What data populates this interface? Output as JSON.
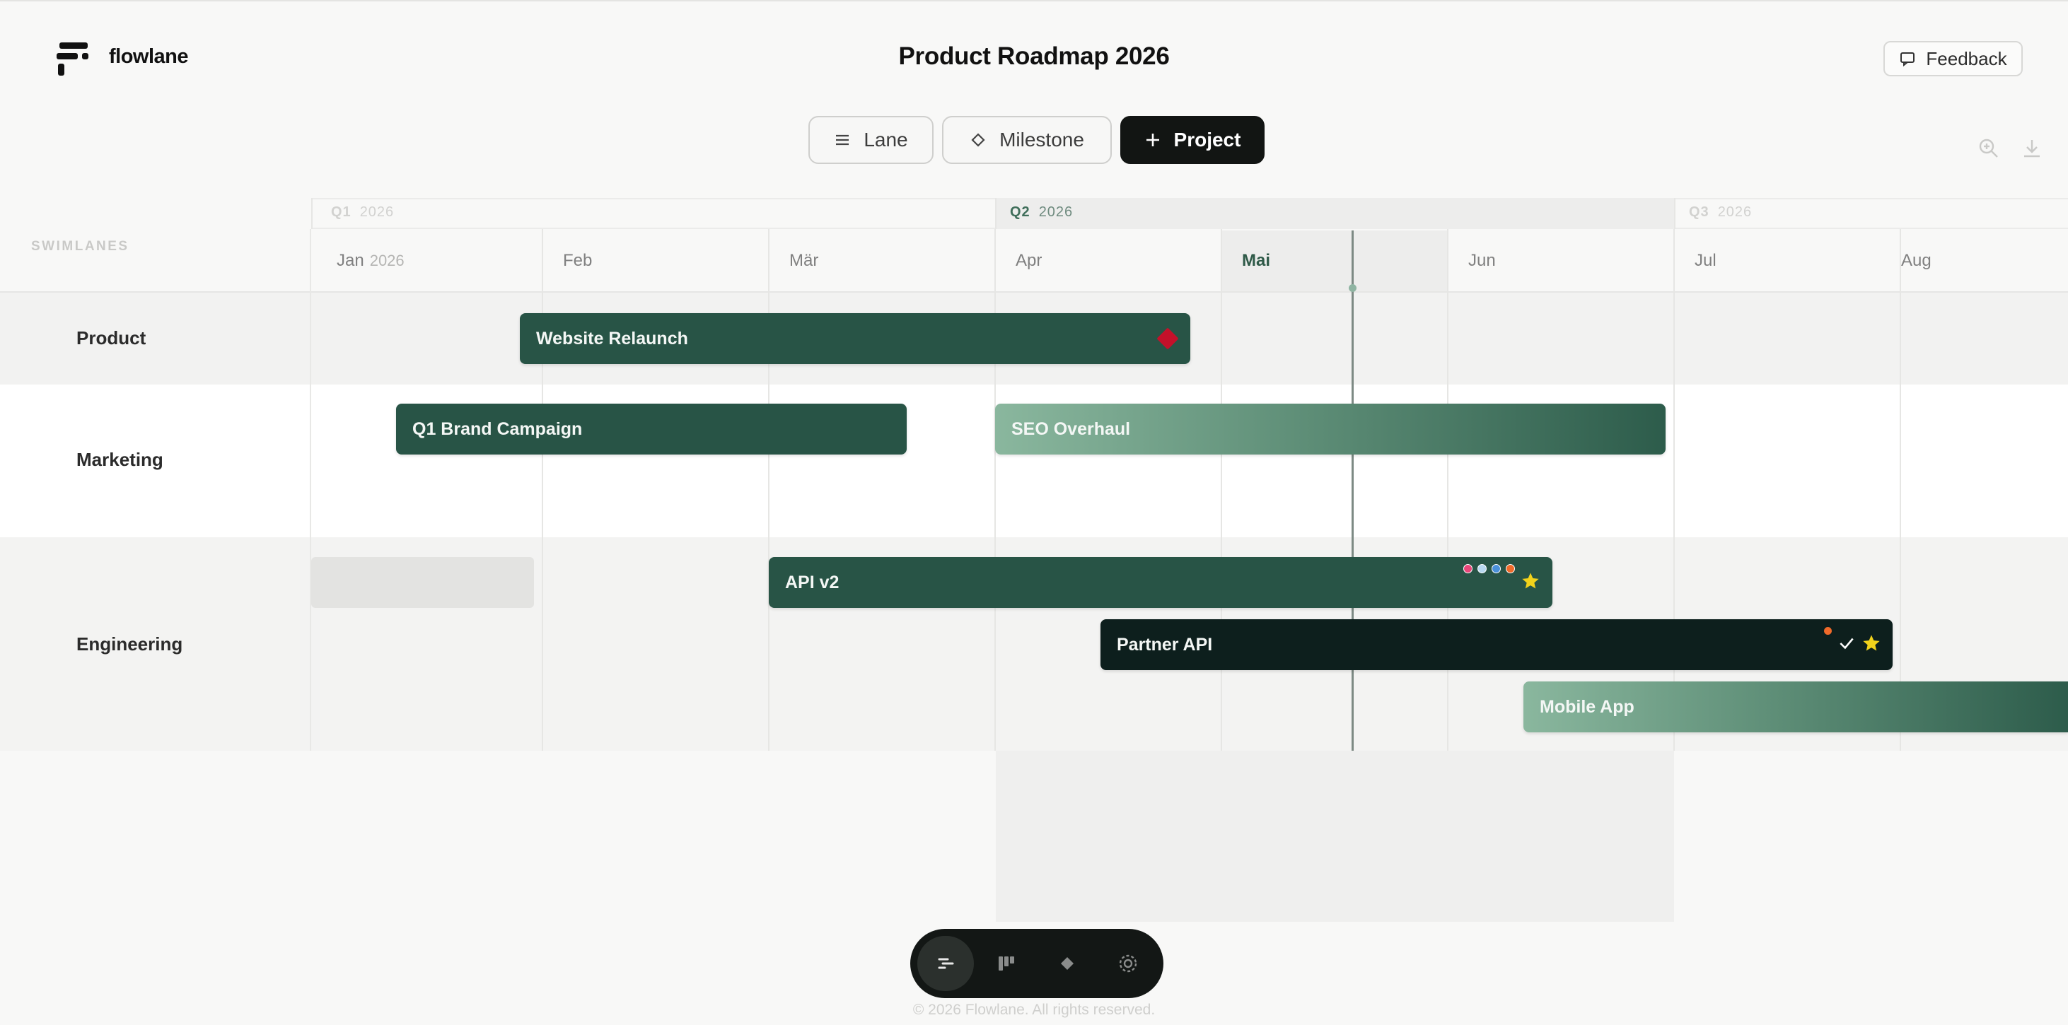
{
  "header": {
    "brand": "flowlane",
    "title": "Product Roadmap 2026",
    "feedback_label": "Feedback"
  },
  "toolbar": {
    "lane_label": "Lane",
    "milestone_label": "Milestone",
    "project_label": "Project",
    "icons": [
      "lane-icon",
      "milestone-icon",
      "plus-icon",
      "zoom-in-icon",
      "download-icon"
    ]
  },
  "timeline": {
    "swimlanes_label": "SWIMLANES",
    "quarters": [
      {
        "label": "Q1",
        "year": "2026"
      },
      {
        "label": "Q2",
        "year": "2026",
        "current": true
      },
      {
        "label": "Q3",
        "year": "2026"
      }
    ],
    "months": [
      {
        "label": "Jan",
        "year": "2026"
      },
      {
        "label": "Feb"
      },
      {
        "label": "Mär"
      },
      {
        "label": "Apr"
      },
      {
        "label": "Mai",
        "current": true
      },
      {
        "label": "Jun"
      },
      {
        "label": "Jul"
      },
      {
        "label": "Aug"
      }
    ]
  },
  "lanes": [
    {
      "name": "Product",
      "projects": [
        {
          "name": "Website Relaunch",
          "style": "solid",
          "markers": [
            "milestone-diamond"
          ]
        }
      ]
    },
    {
      "name": "Marketing",
      "projects": [
        {
          "name": "Q1 Brand Campaign",
          "style": "solid"
        },
        {
          "name": "SEO Overhaul",
          "style": "gradient"
        }
      ]
    },
    {
      "name": "Engineering",
      "projects": [
        {
          "name": "",
          "style": "ghost"
        },
        {
          "name": "API v2",
          "style": "solid",
          "markers": [
            "4-status-dots",
            "star-icon"
          ]
        },
        {
          "name": "Partner API",
          "style": "dark",
          "markers": [
            "status-dot",
            "check-icon",
            "star-icon"
          ]
        },
        {
          "name": "Mobile App",
          "style": "gradient"
        }
      ]
    }
  ],
  "colors": {
    "bar_solid": "#285446",
    "bar_dark": "#0d1f1d",
    "milestone": "#c4102a",
    "star": "#f2d21b",
    "dots": [
      "#e8467a",
      "#b8d8f0",
      "#4a90d9",
      "#f06a2a"
    ],
    "accent": "#3f6e5a"
  },
  "bottom_nav": {
    "items": [
      "timeline-icon",
      "board-icon",
      "milestone-icon",
      "settings-icon"
    ],
    "active": "timeline-icon"
  },
  "footer": {
    "copyright": "© 2026 Flowlane. All rights reserved."
  }
}
